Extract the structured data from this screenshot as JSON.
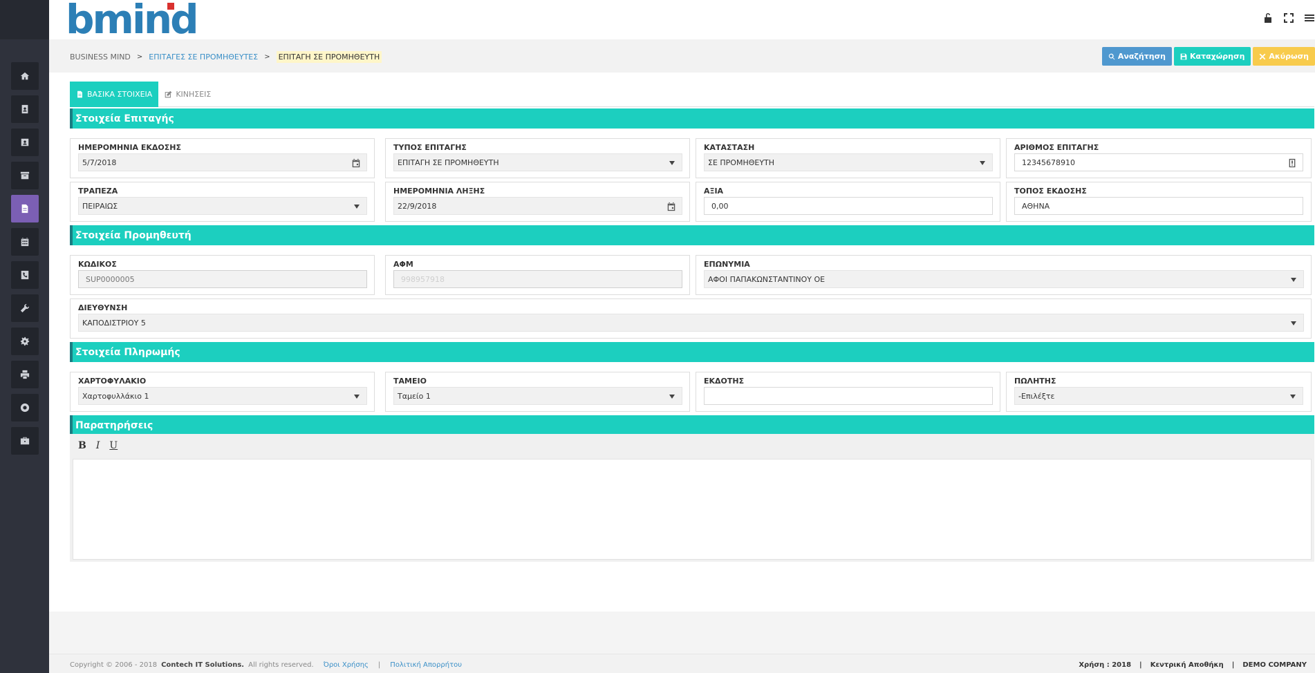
{
  "app": {
    "logo_text": "bmind"
  },
  "breadcrumb": {
    "items": [
      "BUSINESS MIND",
      "ΕΠΙΤΑΓΕΣ ΣΕ ΠΡΟΜΗΘΕΥΤΕΣ",
      "ΕΠΙΤΑΓΗ ΣΕ ΠΡΟΜΗΘΕΥΤΗ"
    ],
    "separator": ">"
  },
  "actions": {
    "search": "Αναζήτηση",
    "save": "Καταχώρηση",
    "cancel": "Ακύρωση"
  },
  "tabs": [
    {
      "label": "ΒΑΣΙΚΑ ΣΤΟΙΧΕΙΑ",
      "active": true
    },
    {
      "label": "ΚΙΝΗΣΕΙΣ",
      "active": false
    }
  ],
  "sections": {
    "check": "Στοιχεία Επιταγής",
    "supplier": "Στοιχεία Προμηθευτή",
    "payment": "Στοιχεία Πληρωμής",
    "notes": "Παρατηρήσεις"
  },
  "check": {
    "issue_date": {
      "label": "ΗΜΕΡΟΜΗΝΙΑ ΕΚΔΟΣΗΣ",
      "value": "5/7/2018"
    },
    "check_type": {
      "label": "ΤΥΠΟΣ ΕΠΙΤΑΓΗΣ",
      "value": "ΕΠΙΤΑΓΗ ΣΕ ΠΡΟΜΗΘΕΥΤΗ"
    },
    "status": {
      "label": "ΚΑΤΑΣΤΑΣΗ",
      "value": "ΣΕ ΠΡΟΜΗΘΕΥΤΗ"
    },
    "check_number": {
      "label": "ΑΡΙΘΜΟΣ ΕΠΙΤΑΓΗΣ",
      "value": "12345678910"
    },
    "bank": {
      "label": "ΤΡΑΠΕΖΑ",
      "value": "ΠΕΙΡΑΙΩΣ"
    },
    "due_date": {
      "label": "ΗΜΕΡΟΜΗΝΙΑ ΛΗΞΗΣ",
      "value": "22/9/2018"
    },
    "amount": {
      "label": "ΑΞΙΑ",
      "value": "0,00"
    },
    "issue_place": {
      "label": "ΤΟΠΟΣ ΕΚΔΟΣΗΣ",
      "value": "ΑΘΗΝΑ"
    }
  },
  "supplier": {
    "code": {
      "label": "ΚΩΔΙΚΟΣ",
      "value": "SUP0000005"
    },
    "vat": {
      "label": "ΑΦΜ",
      "value": "998957918"
    },
    "name": {
      "label": "ΕΠΩΝΥΜΙΑ",
      "value": "ΑΦΟΙ ΠΑΠΑΚΩΝΣΤΑΝΤΙΝΟΥ ΟΕ"
    },
    "address": {
      "label": "ΔΙΕΥΘΥΝΣΗ",
      "value": "ΚΑΠΟΔΙΣΤΡΙΟΥ 5"
    }
  },
  "payment": {
    "portfolio": {
      "label": "ΧΑΡΤΟΦΥΛΑΚΙΟ",
      "value": "Χαρτοφυλλάκιο 1"
    },
    "cashbox": {
      "label": "ΤΑΜΕΙΟ",
      "value": "Ταμείο 1"
    },
    "issuer": {
      "label": "ΕΚΔΟΤΗΣ",
      "value": ""
    },
    "seller": {
      "label": "ΠΩΛΗΤΗΣ",
      "value": "-Επιλέξτε"
    }
  },
  "editor": {
    "bold": "B",
    "italic": "I",
    "underline": "U"
  },
  "footer": {
    "copyright": "Copyright © 2006 - 2018",
    "company": "Contech IT Solutions.",
    "rights": "All rights reserved.",
    "terms": "Όροι Χρήσης",
    "privacy": "Πολιτική Απορρήτου",
    "divider": "|",
    "year": "Χρήση : 2018",
    "warehouse": "Κεντρική Αποθήκη",
    "demo": "DEMO COMPANY"
  },
  "icons": {
    "sidebar": [
      "home-icon",
      "address-book-icon",
      "contact-card-icon",
      "archive-icon",
      "document-icon",
      "calendar-icon",
      "phone-book-icon",
      "wrench-icon",
      "gear-icon",
      "printer-icon",
      "lifebuoy-icon",
      "briefcase-icon"
    ],
    "header": [
      "unlock-icon",
      "fullscreen-icon",
      "menu-icon"
    ]
  },
  "colors": {
    "accent": "#1ccfbf",
    "sidebar": "#2f323c",
    "active_nav": "#7b5fb4",
    "search_btn": "#4f98cf",
    "cancel_btn": "#f8cb4c",
    "brand": "#2c7fb6"
  }
}
